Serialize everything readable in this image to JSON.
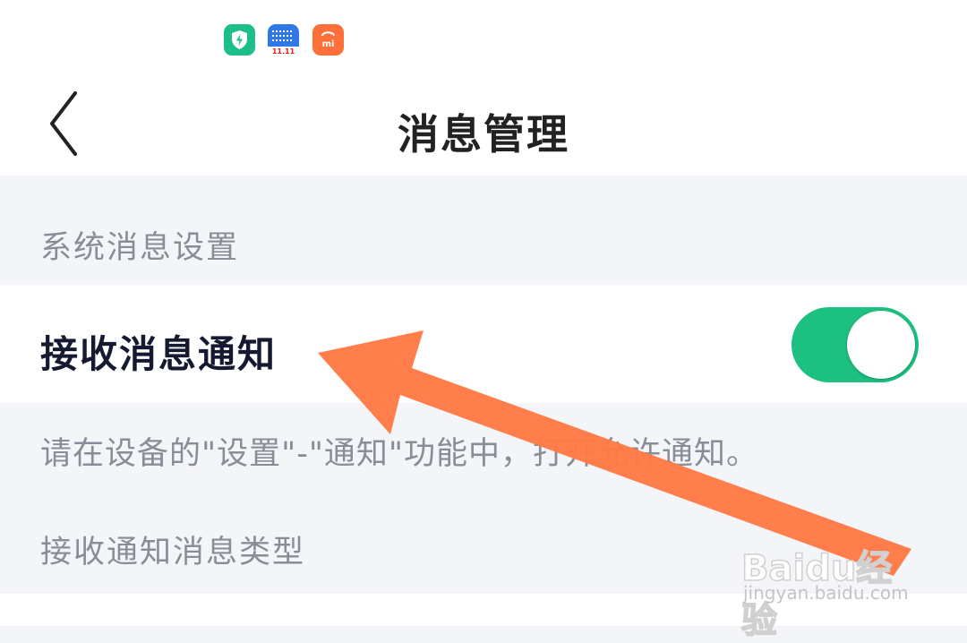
{
  "status_bar": {
    "icons": [
      {
        "name": "security-app-icon",
        "color": "#1dbf87"
      },
      {
        "name": "shopping-festival-app-icon",
        "color": "#2f78e6",
        "text": "11.11"
      },
      {
        "name": "mi-store-app-icon",
        "color": "#ff6f3a",
        "text": "mi"
      }
    ]
  },
  "header": {
    "title": "消息管理",
    "back_icon": "chevron-left-icon"
  },
  "section": {
    "title": "系统消息设置"
  },
  "notification_row": {
    "label": "接收消息通知",
    "toggle_on": true,
    "toggle_color": "#1cc080"
  },
  "hint": "请在设备的\"设置\"-\"通知\"功能中，打开允许通知。",
  "types": {
    "label": "接收通知消息类型"
  },
  "annotation": {
    "arrow_color": "#ff7a45"
  },
  "watermark": {
    "brand": "Baidu经验",
    "url": "jingyan.baidu.com"
  }
}
